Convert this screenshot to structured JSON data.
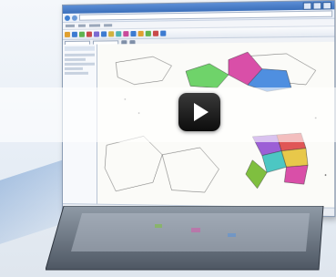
{
  "video": {
    "play_button_label": "",
    "icon": "play-icon"
  },
  "colors": {
    "titlebar": "#3b6fba",
    "map_regions": [
      "#d94fa8",
      "#6fd36a",
      "#4f8fe0",
      "#e8c84a",
      "#9c5fd6",
      "#4cc7c3",
      "#e05656",
      "#7fbf3f"
    ]
  }
}
